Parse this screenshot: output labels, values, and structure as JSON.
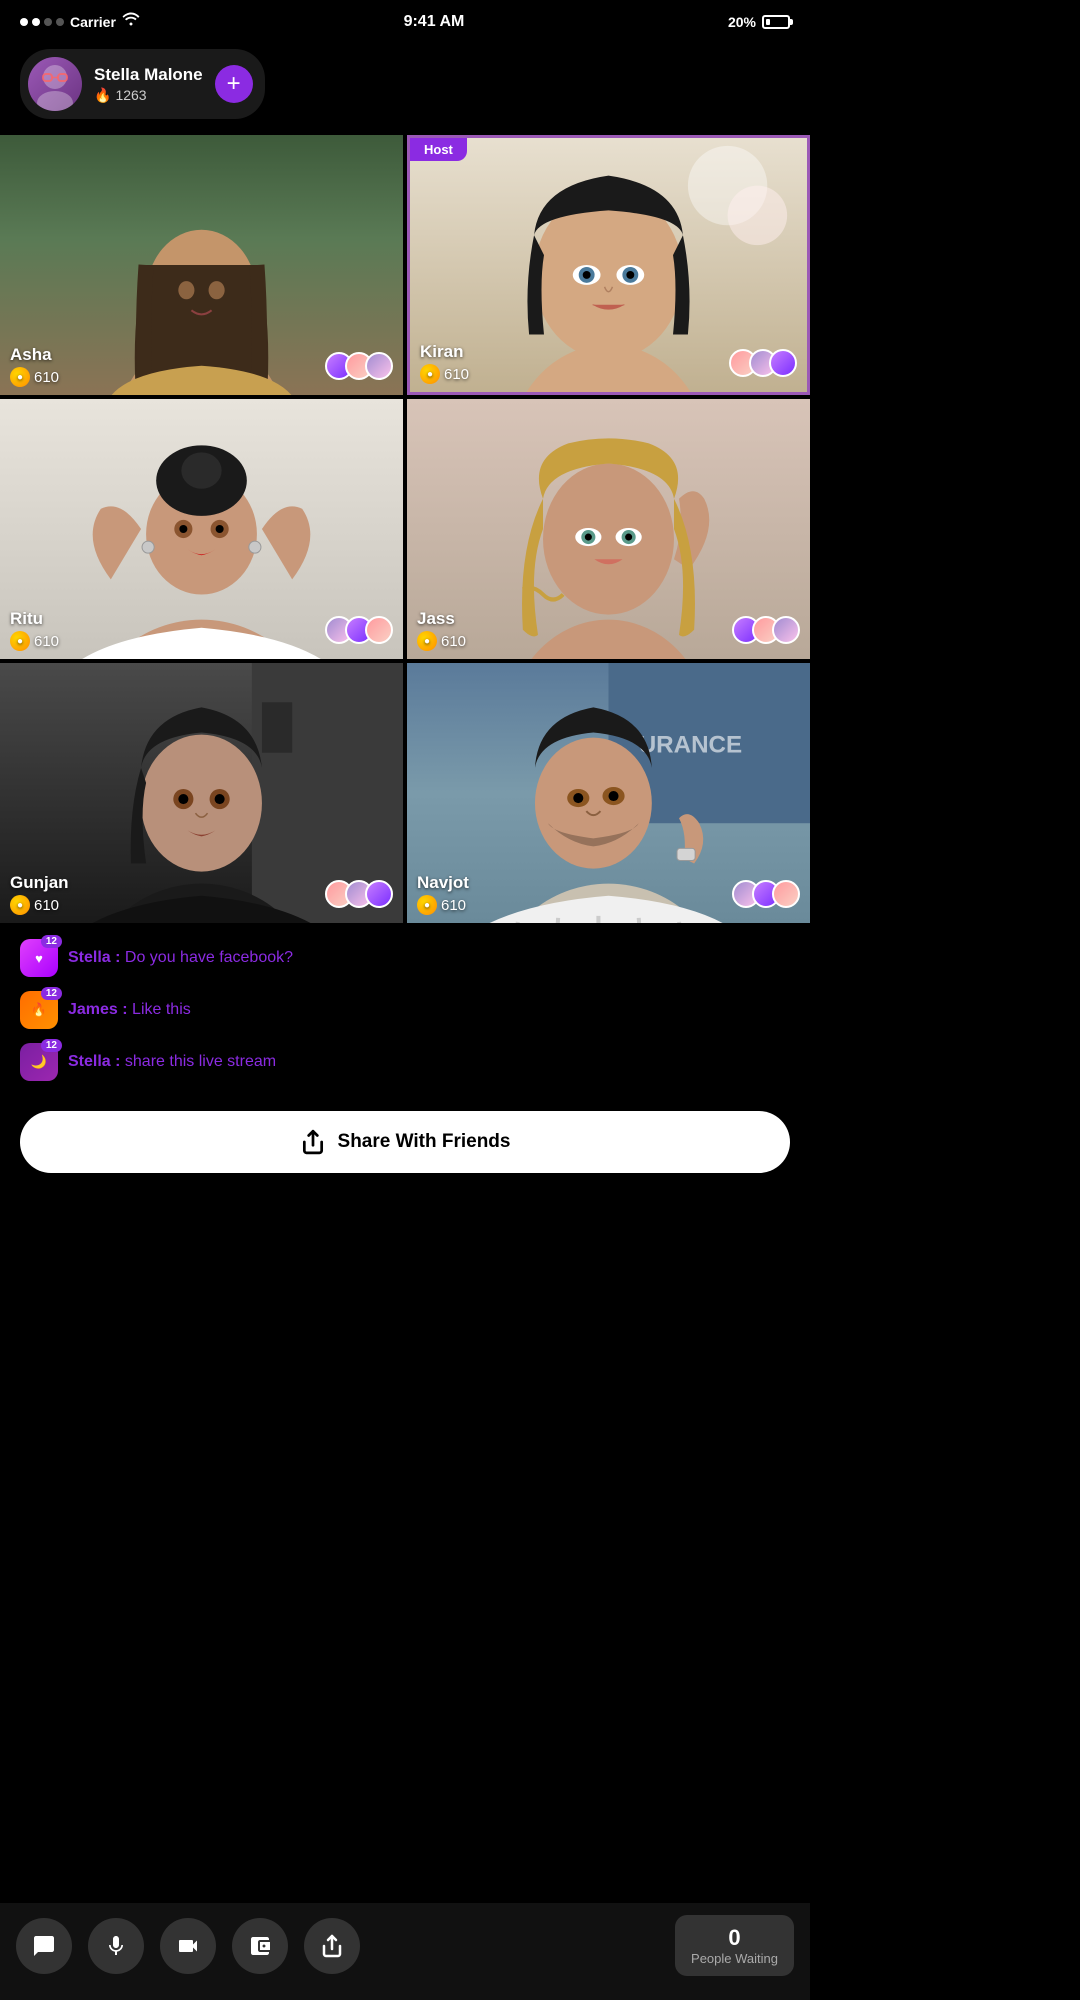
{
  "statusBar": {
    "carrier": "Carrier",
    "time": "9:41 AM",
    "battery": "20%"
  },
  "userCard": {
    "name": "Stella Malone",
    "score": "1263",
    "addButtonLabel": "+"
  },
  "videoGrid": [
    {
      "id": "asha",
      "name": "Asha",
      "coins": "610",
      "isHost": false,
      "cellClass": "cell-asha"
    },
    {
      "id": "kiran",
      "name": "Kiran",
      "coins": "610",
      "isHost": true,
      "hostLabel": "Host",
      "cellClass": "cell-kiran"
    },
    {
      "id": "ritu",
      "name": "Ritu",
      "coins": "610",
      "isHost": false,
      "cellClass": "cell-ritu"
    },
    {
      "id": "jass",
      "name": "Jass",
      "coins": "610",
      "isHost": false,
      "cellClass": "cell-jass"
    },
    {
      "id": "gunjan",
      "name": "Gunjan",
      "coins": "610",
      "isHost": false,
      "cellClass": "cell-gunjan"
    },
    {
      "id": "navjot",
      "name": "Navjot",
      "coins": "610",
      "isHost": false,
      "cellClass": "cell-navjot"
    }
  ],
  "chat": {
    "messages": [
      {
        "user": "Stella",
        "text": "Do you have facebook?",
        "badgeType": "heart",
        "badgeNumber": "12"
      },
      {
        "user": "James",
        "text": "Like this",
        "badgeType": "fire",
        "badgeNumber": "12"
      },
      {
        "user": "Stella",
        "text": "share this live stream",
        "badgeType": "moon",
        "badgeNumber": "12"
      }
    ]
  },
  "shareButton": {
    "label": "Share With Friends"
  },
  "bottomNav": {
    "buttons": [
      {
        "id": "chat",
        "icon": "💬",
        "label": "chat"
      },
      {
        "id": "mic",
        "icon": "🎤",
        "label": "microphone"
      },
      {
        "id": "video",
        "icon": "🎥",
        "label": "video"
      },
      {
        "id": "wallet",
        "icon": "👛",
        "label": "wallet"
      },
      {
        "id": "share",
        "icon": "📤",
        "label": "share"
      }
    ],
    "peopleWaiting": {
      "count": "0",
      "label": "People Waiting"
    }
  },
  "icons": {
    "flame": "🔥",
    "coin": "🪙",
    "heart": "♥",
    "fire": "🔥",
    "moon": "🌙",
    "share": "↗"
  }
}
